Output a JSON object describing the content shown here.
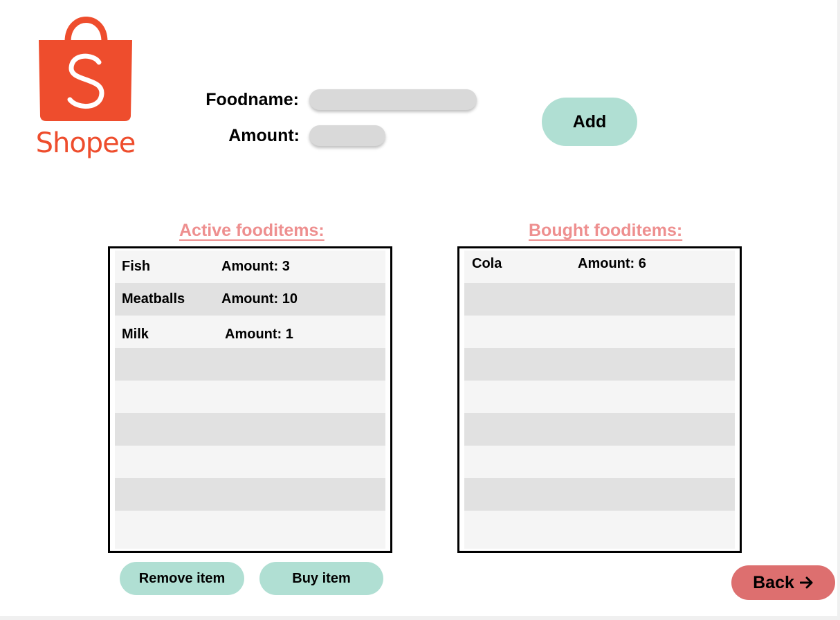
{
  "brand": {
    "name": "Shopee",
    "logo_letter": "S",
    "color": "#ee4d2d"
  },
  "form": {
    "foodname_label": "Foodname:",
    "foodname_value": "",
    "amount_label": "Amount:",
    "amount_value": "",
    "add_button": "Add"
  },
  "active_list": {
    "title": "Active fooditems:",
    "items": [
      {
        "name": "Fish",
        "amount": "Amount: 3"
      },
      {
        "name": "Meatballs",
        "amount": "Amount: 10"
      },
      {
        "name": "Milk",
        "amount": "Amount: 1"
      }
    ]
  },
  "bought_list": {
    "title": "Bought fooditems:",
    "items": [
      {
        "name": "Cola",
        "amount": "Amount: 6"
      }
    ]
  },
  "actions": {
    "remove_button": "Remove item",
    "buy_button": "Buy item",
    "back_button": "Back",
    "back_icon": "arrow-right-icon"
  },
  "colors": {
    "accent_teal": "#b0dfd3",
    "heading_pink": "#ee8f8f",
    "back_red": "#dd6f6f",
    "row_light": "#f5f5f5",
    "row_dark": "#e1e1e1",
    "input_gray": "#d9d9d9"
  }
}
